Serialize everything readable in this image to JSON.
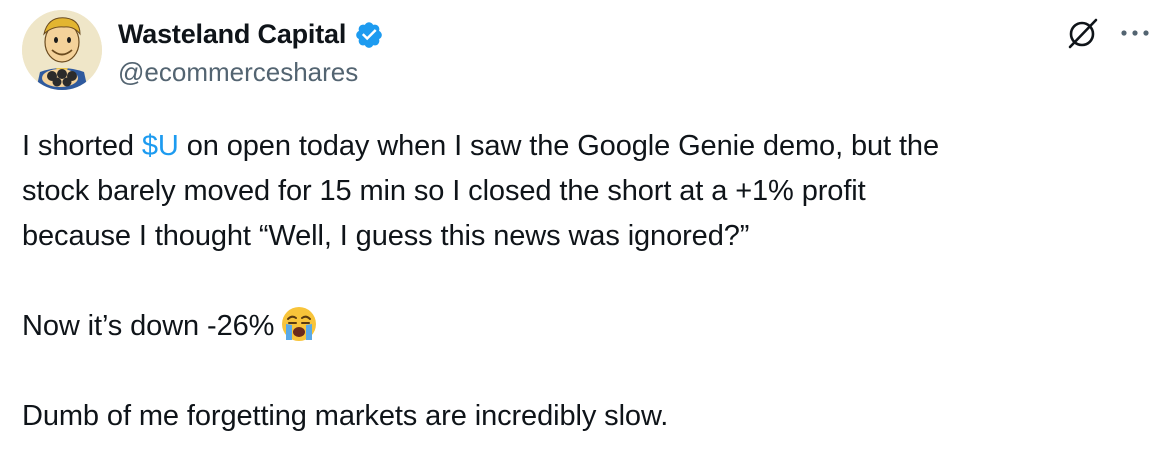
{
  "author": {
    "display_name": "Wasteland Capital",
    "handle": "@ecommerceshares",
    "verified": true,
    "avatar_icon": "vault-boy-avatar-icon"
  },
  "actions": {
    "grok_icon": "grok-slash-icon",
    "more_icon": "more-dots-icon"
  },
  "tweet": {
    "line1_pre": "I shorted ",
    "cashtag": "$U",
    "line1_post": " on open today when I saw the Google Genie demo, but the",
    "line2": "stock barely moved for 15 min so I closed the short at a +1% profit",
    "line3": "because I thought “Well, I guess this news was ignored?”",
    "line4": "Now it’s down -26%",
    "line4_emoji": "crying-face-emoji",
    "line5": "Dumb of me forgetting markets are incredibly slow."
  },
  "colors": {
    "text": "#0f1419",
    "secondary": "#536471",
    "accent": "#1d9bf0"
  }
}
